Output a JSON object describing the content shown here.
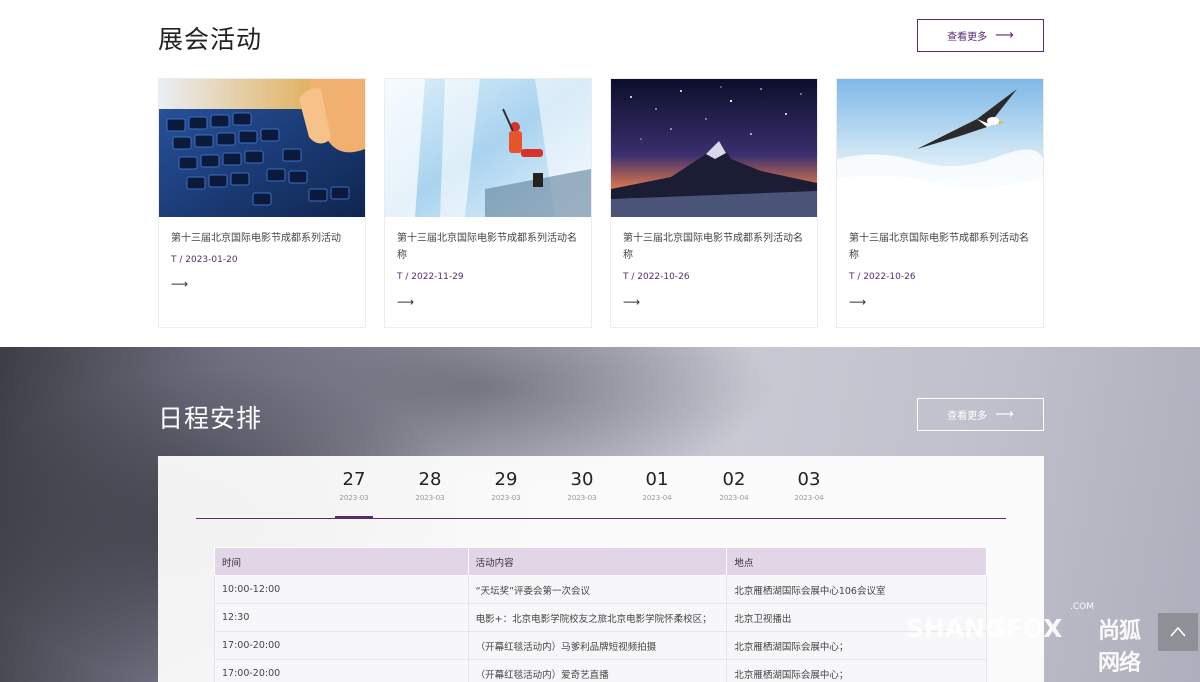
{
  "colors": {
    "accent": "#5b2a6e",
    "table_header": "#e3d5e8"
  },
  "exhibitions": {
    "title": "展会活动",
    "more_label": "查看更多",
    "more_arrow": "⟶",
    "cards": [
      {
        "title": "第十三届北京国际电影节成都系列活动",
        "date": "T / 2023-01-20",
        "arrow": "⟶",
        "image": "keyboard-hand"
      },
      {
        "title": "第十三届北京国际电影节成都系列活动名称",
        "date": "T / 2022-11-29",
        "arrow": "⟶",
        "image": "ice-climber"
      },
      {
        "title": "第十三届北京国际电影节成都系列活动名称",
        "date": "T / 2022-10-26",
        "arrow": "⟶",
        "image": "starry-mountain"
      },
      {
        "title": "第十三届北京国际电影节成都系列活动名称",
        "date": "T / 2022-10-26",
        "arrow": "⟶",
        "image": "eagle-clouds"
      }
    ]
  },
  "schedule": {
    "title": "日程安排",
    "more_label": "查看更多",
    "more_arrow": "⟶",
    "dates": [
      {
        "day": "27",
        "ym": "2023-03",
        "active": true
      },
      {
        "day": "28",
        "ym": "2023-03",
        "active": false
      },
      {
        "day": "29",
        "ym": "2023-03",
        "active": false
      },
      {
        "day": "30",
        "ym": "2023-03",
        "active": false
      },
      {
        "day": "01",
        "ym": "2023-04",
        "active": false
      },
      {
        "day": "02",
        "ym": "2023-04",
        "active": false
      },
      {
        "day": "03",
        "ym": "2023-04",
        "active": false
      }
    ],
    "table": {
      "headers": [
        "时间",
        "活动内容",
        "地点"
      ],
      "rows": [
        [
          "10:00-12:00",
          "“天坛奖”评委会第一次会议",
          "北京雁栖湖国际会展中心106会议室"
        ],
        [
          "12:30",
          "电影+：北京电影学院校友之旅北京电影学院怀柔校区；",
          "北京卫视播出"
        ],
        [
          "17:00-20:00",
          "（开幕红毯活动内）马爹利品牌短视频拍摄",
          "北京雁栖湖国际会展中心；"
        ],
        [
          "17:00-20:00",
          "（开幕红毯活动内）爱奇艺直播",
          "北京雁栖湖国际会展中心；"
        ]
      ]
    }
  },
  "watermark": {
    "brand": "SHANGFOX",
    "brand_cn": "尚狐网络",
    "suffix": ".COM"
  },
  "back_to_top": {
    "icon": "chevron-up-icon"
  }
}
